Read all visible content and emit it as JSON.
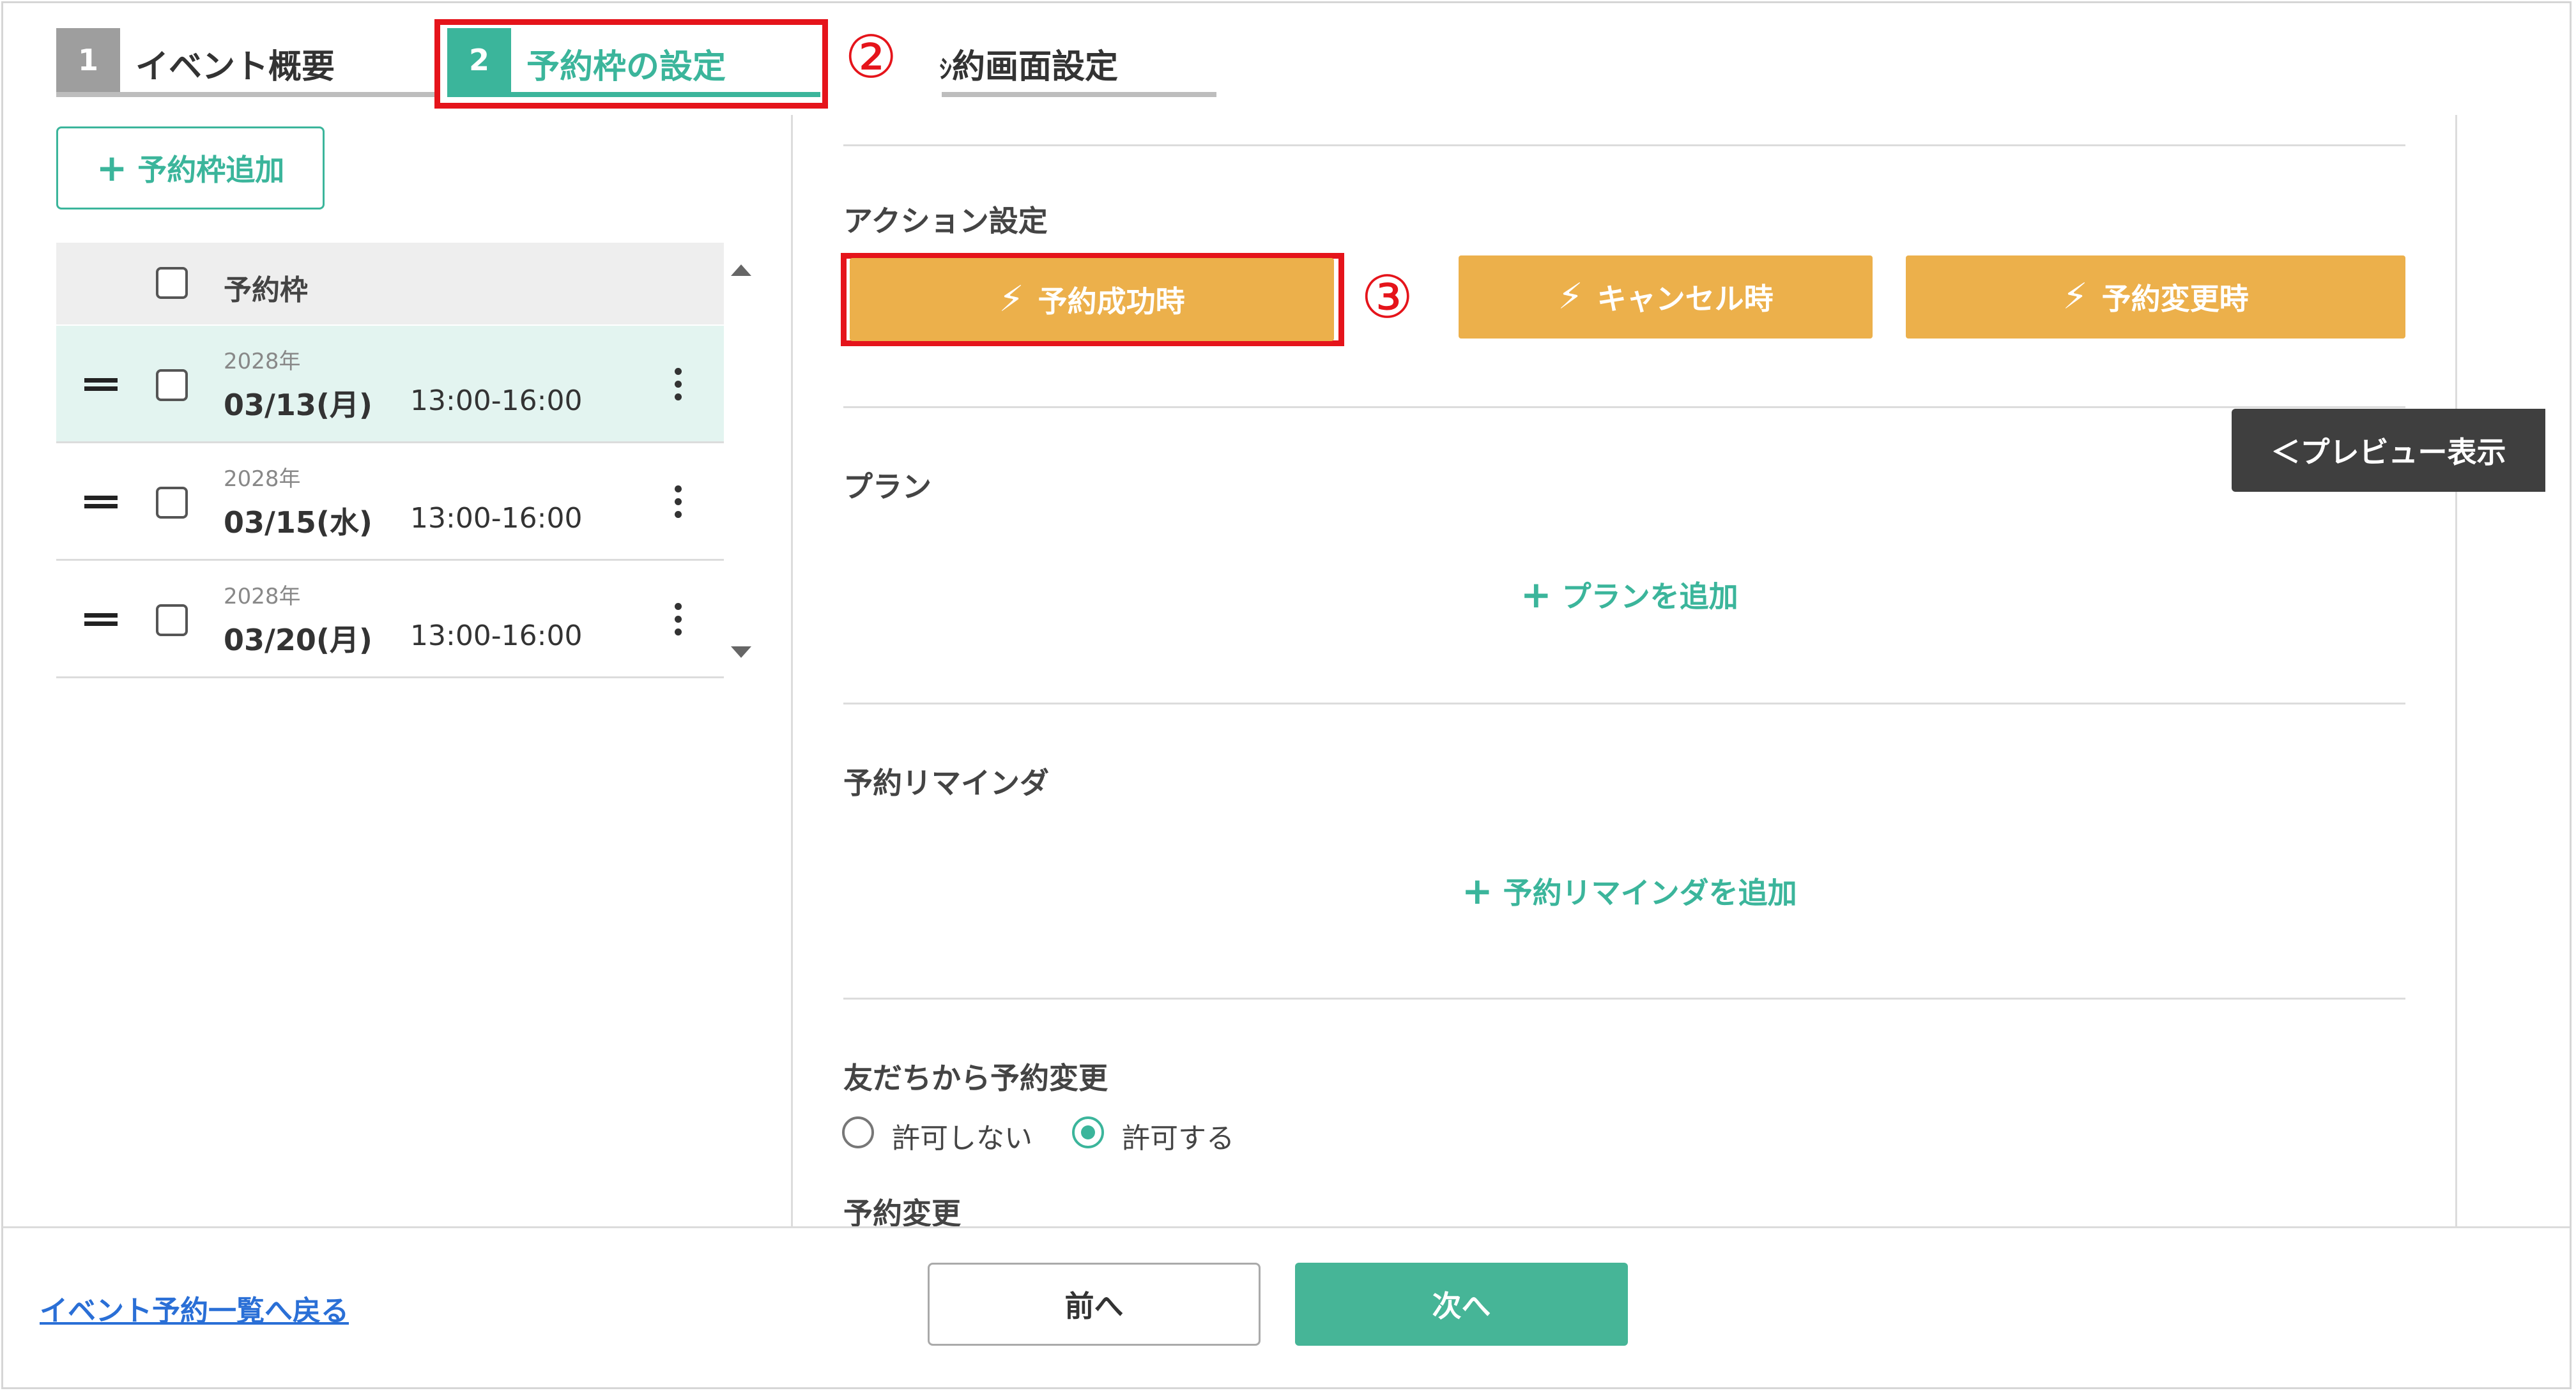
{
  "tabs": [
    {
      "num": "1",
      "label": "イベント概要",
      "num_color": "#9e9e9e"
    },
    {
      "num": "2",
      "label": "予約枠の設定",
      "num_color": "#3bb59b"
    },
    {
      "label": "約画面設定",
      "leading_fragment": "ｼ"
    }
  ],
  "annotations": {
    "step2": "②",
    "step3": "③"
  },
  "left": {
    "add_slot_label": "予約枠追加",
    "table_header": "予約枠",
    "rows": [
      {
        "year": "2028年",
        "date": "03/13(月)",
        "time": "13:00-16:00",
        "selected": true
      },
      {
        "year": "2028年",
        "date": "03/15(水)",
        "time": "13:00-16:00",
        "selected": false
      },
      {
        "year": "2028年",
        "date": "03/20(月)",
        "time": "13:00-16:00",
        "selected": false
      }
    ]
  },
  "main": {
    "action_settings": {
      "title": "アクション設定",
      "buttons": [
        "予約成功時",
        "キャンセル時",
        "予約変更時"
      ]
    },
    "plan": {
      "title": "プラン",
      "add_label": "プランを追加"
    },
    "reminder": {
      "title": "予約リマインダ",
      "add_label": "予約リマインダを追加"
    },
    "friend_change": {
      "title": "友だちから予約変更",
      "options": [
        "許可しない",
        "許可する"
      ],
      "selected": "許可する"
    },
    "reservation_change": {
      "title": "予約変更"
    }
  },
  "preview_label": "＜プレビュー表示",
  "footer": {
    "back_link": "イベント予約一覧へ戻る",
    "prev_label": "前へ",
    "next_label": "次へ"
  },
  "colors": {
    "accent_green": "#3bb59b",
    "action_orange": "#ecb04b",
    "highlight_red": "#e5141b",
    "link_blue": "#2a6fd6",
    "preview_dark": "#3f3f3f"
  }
}
